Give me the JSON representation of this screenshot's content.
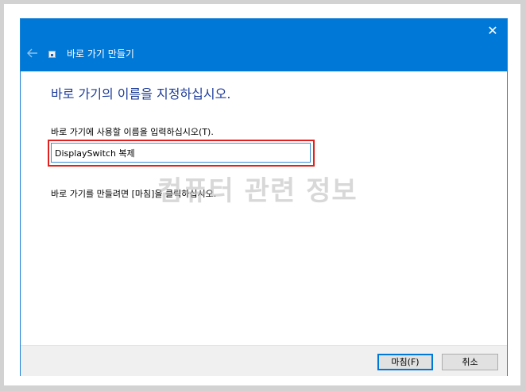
{
  "window": {
    "title": "바로 가기 만들기",
    "close_glyph": "✕"
  },
  "content": {
    "heading": "바로 가기의 이름을 지정하십시오.",
    "field_label": "바로 가기에 사용할 이름을 입력하십시오(T).",
    "name_value": "DisplaySwitch 복제",
    "instruction": "바로 가기를 만들려면 [마침]을 클릭하십시오."
  },
  "watermark": "컴퓨터 관련 정보",
  "footer": {
    "finish_label": "마침(F)",
    "cancel_label": "취소"
  },
  "colors": {
    "titlebar": "#0078d7",
    "heading": "#1e3c9a",
    "highlight": "#e0211d"
  },
  "icons": {
    "back": "arrow-left-icon",
    "app": "shortcut-app-icon",
    "close": "close-icon"
  }
}
